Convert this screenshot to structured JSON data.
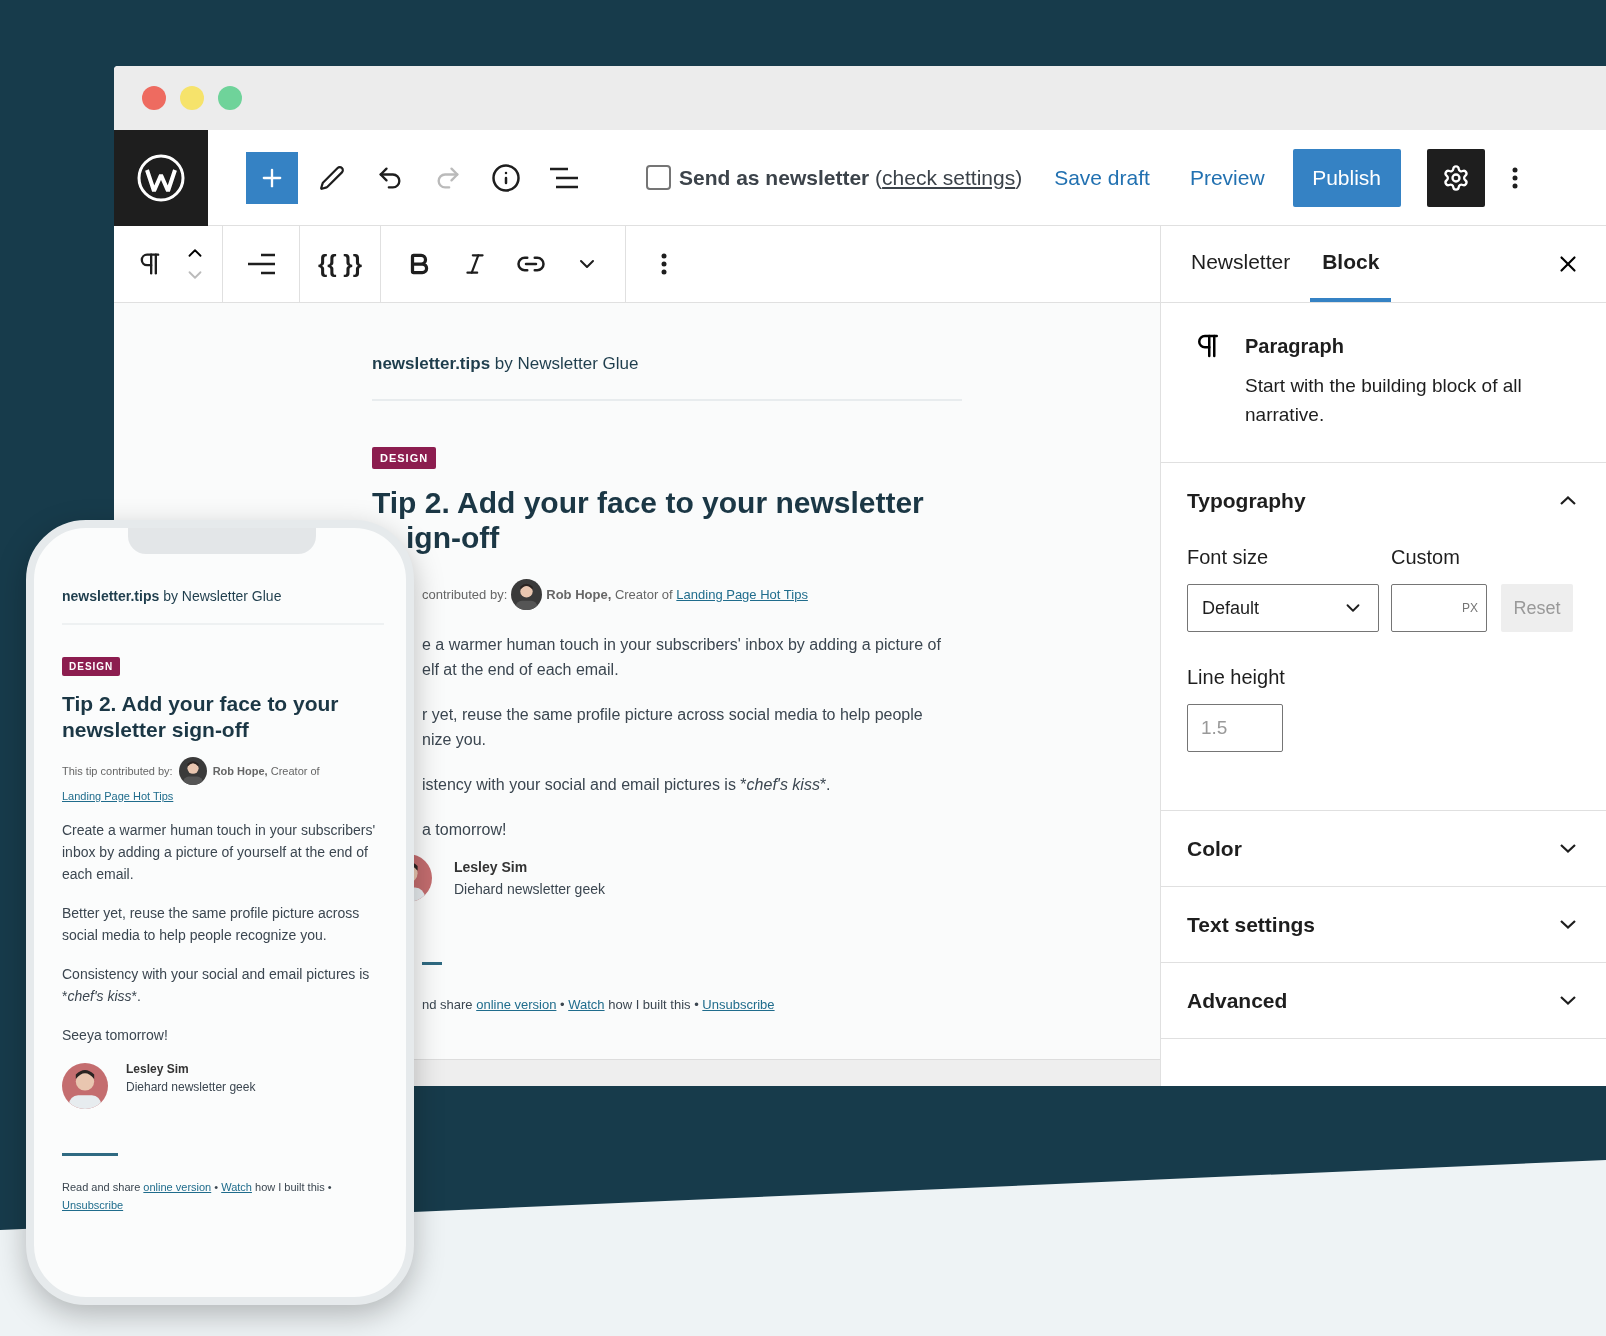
{
  "top_bar": {
    "redo": {
      "disabled": true
    },
    "newsletter_option": {
      "label": "Send as newsletter",
      "paren_open": "(",
      "link": "check settings",
      "paren_close": ")",
      "checked": false
    },
    "save_draft": "Save draft",
    "preview": "Preview",
    "publish": "Publish",
    "settings": {
      "selected": true
    }
  },
  "block_toolbar": {
    "variables": "{{ }}"
  },
  "editor": {
    "site": "newsletter.tips",
    "site_by": "by Newsletter Glue",
    "tag": "DESIGN",
    "title_lines": [
      "Tip 2. Add your face to your newsletter",
      "ign-off"
    ],
    "contributor": {
      "prefix": "contributed by:",
      "name": "Rob Hope,",
      "role": "Creator of",
      "link": "Landing Page Hot Tips"
    },
    "paragraphs": [
      [
        {
          "text": "e a warmer human touch in your subscribers' inbox by adding a picture of",
          "kind": "plain"
        }
      ],
      [
        {
          "text": "elf at the end of each email.",
          "kind": "plain"
        }
      ],
      [
        {
          "text": "r yet, reuse the same profile picture across social media to help people",
          "kind": "plain"
        }
      ],
      [
        {
          "text": "nize you.",
          "kind": "plain"
        }
      ],
      [
        {
          "text": "istency with your social and email pictures is *",
          "kind": "plain"
        },
        {
          "text": "chef's kiss",
          "kind": "italic"
        },
        {
          "text": "*.",
          "kind": "plain"
        }
      ],
      [
        {
          "text": "a tomorrow!",
          "kind": "plain"
        }
      ]
    ],
    "signoff": {
      "name": "Lesley Sim",
      "role": "Diehard newsletter geek"
    },
    "footer": [
      {
        "kind": "text",
        "text": "nd share "
      },
      {
        "kind": "link",
        "text": "online version"
      },
      {
        "kind": "text",
        "text": " • "
      },
      {
        "kind": "link",
        "text": "Watch"
      },
      {
        "kind": "text",
        "text": " how I built this • "
      },
      {
        "kind": "link",
        "text": "Unsubscribe"
      }
    ]
  },
  "phone": {
    "site": "newsletter.tips",
    "site_by": "by Newsletter Glue",
    "tag": "DESIGN",
    "title": "Tip 2. Add your face to your newsletter sign-off",
    "contributor": {
      "prefix": "This tip contributed by:",
      "name": "Rob Hope,",
      "role": "Creator of",
      "link": "Landing Page Hot Tips"
    },
    "paragraphs": [
      [
        {
          "text": "Create a warmer human touch in your subscribers' inbox by adding a picture of yourself at the end of each email.",
          "kind": "plain"
        }
      ],
      [
        {
          "text": "Better yet, reuse the same profile picture across social media to help people recognize you.",
          "kind": "plain"
        }
      ],
      [
        {
          "text": "Consistency with your social and email pictures is *",
          "kind": "plain"
        },
        {
          "text": "chef's kiss",
          "kind": "italic"
        },
        {
          "text": "*.",
          "kind": "plain"
        }
      ],
      [
        {
          "text": "Seeya tomorrow!",
          "kind": "plain"
        }
      ]
    ],
    "signoff": {
      "name": "Lesley Sim",
      "role": "Diehard newsletter geek"
    },
    "footer": [
      {
        "kind": "text",
        "text": "Read and share "
      },
      {
        "kind": "link",
        "text": "online version"
      },
      {
        "kind": "text",
        "text": " • "
      },
      {
        "kind": "link",
        "text": "Watch"
      },
      {
        "kind": "text",
        "text": " how I built this • "
      },
      {
        "kind": "link",
        "text": "Unsubscribe"
      }
    ]
  },
  "sidebar": {
    "tabs": [
      {
        "label": "Newsletter",
        "selected": false
      },
      {
        "label": "Block",
        "selected": true
      }
    ],
    "block": {
      "name": "Paragraph",
      "description": "Start with the building block of all narrative."
    },
    "typography": {
      "font_size_label": "Font size",
      "font_size_value": "Default",
      "custom_label": "Custom",
      "custom_unit": "PX",
      "reset": {
        "label": "Reset",
        "disabled": true
      },
      "line_height_label": "Line height",
      "line_height_placeholder": "1.5"
    },
    "panels": [
      {
        "title": "Typography",
        "expanded": true
      },
      {
        "title": "Color",
        "expanded": false
      },
      {
        "title": "Text settings",
        "expanded": false
      },
      {
        "title": "Advanced",
        "expanded": false
      }
    ]
  }
}
